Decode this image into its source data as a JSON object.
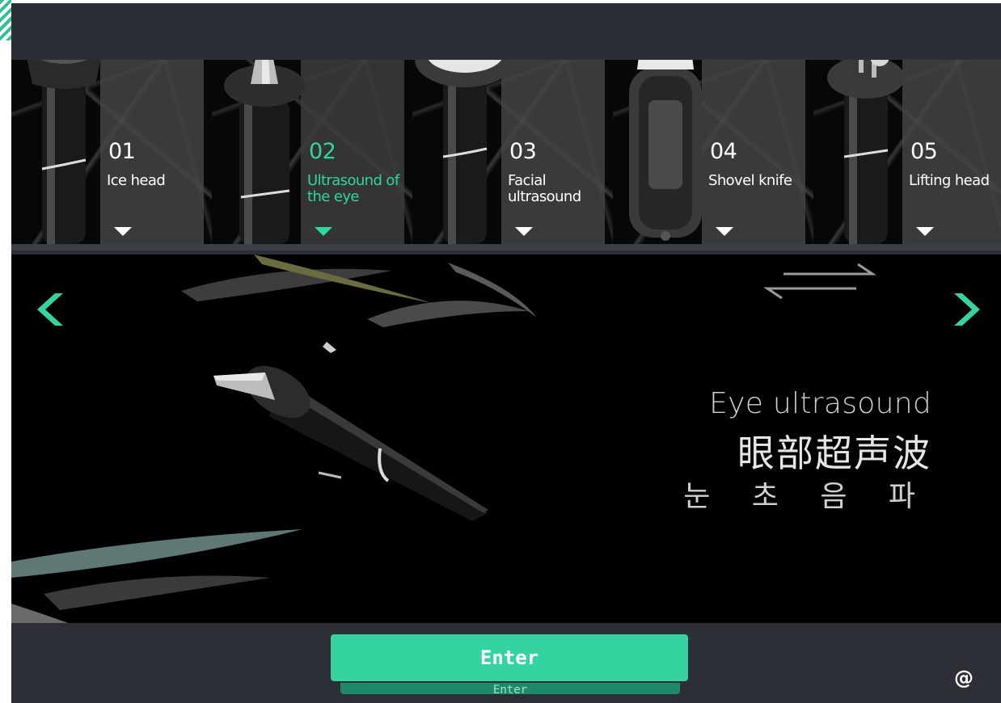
{
  "heads": [
    {
      "num": "01",
      "name": "Ice head"
    },
    {
      "num": "02",
      "name": "Ultrasound of the eye"
    },
    {
      "num": "03",
      "name": "Facial ultrasound"
    },
    {
      "num": "04",
      "name": "Shovel knife"
    },
    {
      "num": "05",
      "name": "Lifting head"
    }
  ],
  "active_index": 1,
  "main": {
    "title_en": "Eye ultrasound",
    "title_cn": "眼部超声波",
    "title_kr": "눈 초 음 파"
  },
  "enter_label": "Enter",
  "enter_reflection": "Enter",
  "at_symbol": "@",
  "colors": {
    "accent": "#35d3a0",
    "background": "#2c2f36",
    "stage": "#000000"
  },
  "icons": [
    "chevron-left-icon",
    "chevron-right-icon",
    "swap-arrows-icon",
    "at-icon"
  ]
}
